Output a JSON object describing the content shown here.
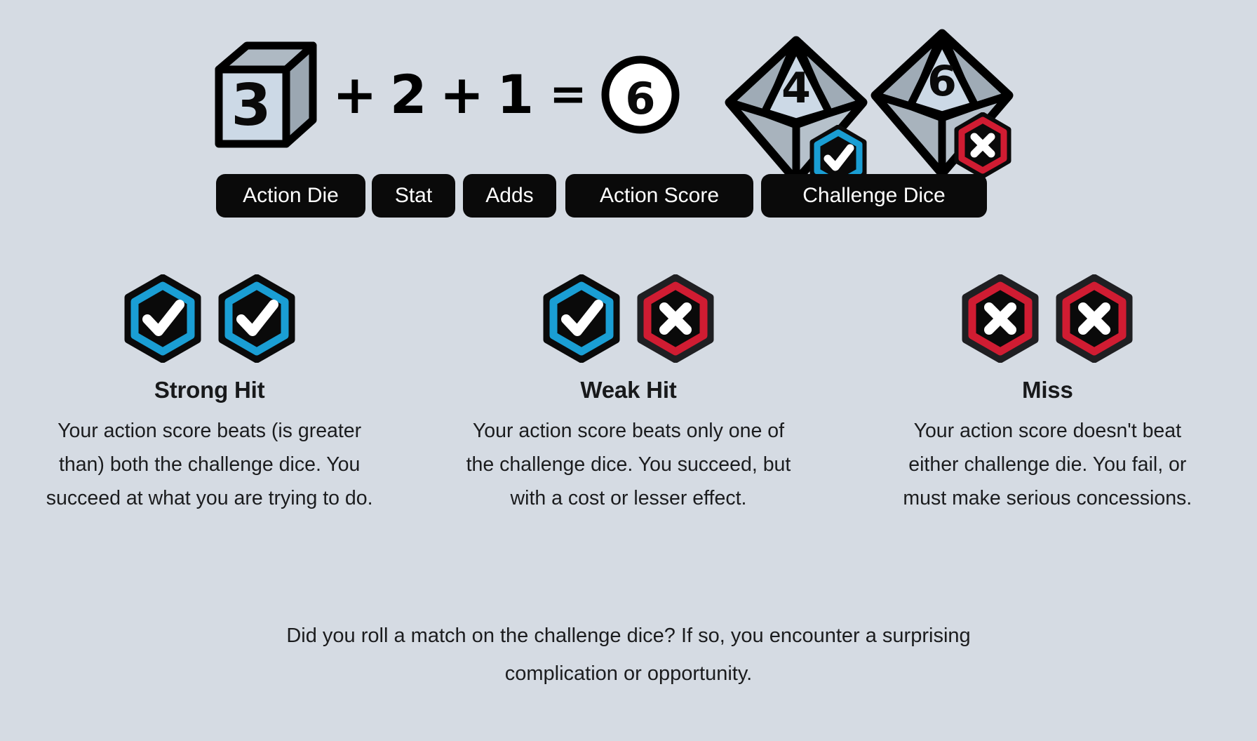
{
  "background_color": "#d5dbe3",
  "colors": {
    "blue": "#1a9ed4",
    "red": "#d01c32",
    "black": "#0a0a0a",
    "die_face_light": "#ccd9e6",
    "die_face_mid": "#a8b3bd",
    "die_face_dark": "#97a3ad",
    "white": "#ffffff"
  },
  "equation": {
    "action_die": {
      "value": "3",
      "icon": "d6-cube-die"
    },
    "plus_1": "+",
    "stat": "2",
    "plus_2": "+",
    "adds": "1",
    "equals": "=",
    "action_score": {
      "value": "6",
      "icon": "circle-token"
    },
    "challenge_dice": [
      {
        "value": "4",
        "icon": "d10-die",
        "badge": "check-badge-blue"
      },
      {
        "value": "6",
        "icon": "d10-die",
        "badge": "x-badge-red"
      }
    ]
  },
  "pills": [
    {
      "label": "Action Die"
    },
    {
      "label": "Stat"
    },
    {
      "label": "Adds"
    },
    {
      "label": "Action Score"
    },
    {
      "label": "Challenge Dice"
    }
  ],
  "outcomes": [
    {
      "title": "Strong Hit",
      "badges": [
        "check-badge-blue",
        "check-badge-blue"
      ],
      "description": "Your action score beats (is greater than) both the challenge dice. You succeed at what you are trying to do."
    },
    {
      "title": "Weak Hit",
      "badges": [
        "check-badge-blue",
        "x-badge-red"
      ],
      "description": "Your action score beats only one of the challenge dice. You succeed, but with a cost or lesser effect."
    },
    {
      "title": "Miss",
      "badges": [
        "x-badge-red",
        "x-badge-red"
      ],
      "description": "Your action score doesn't beat either challenge die. You fail, or must make serious concessions."
    }
  ],
  "footer": {
    "note": "Did you roll a match on the challenge dice? If so, you encounter a surprising complication or opportunity."
  }
}
